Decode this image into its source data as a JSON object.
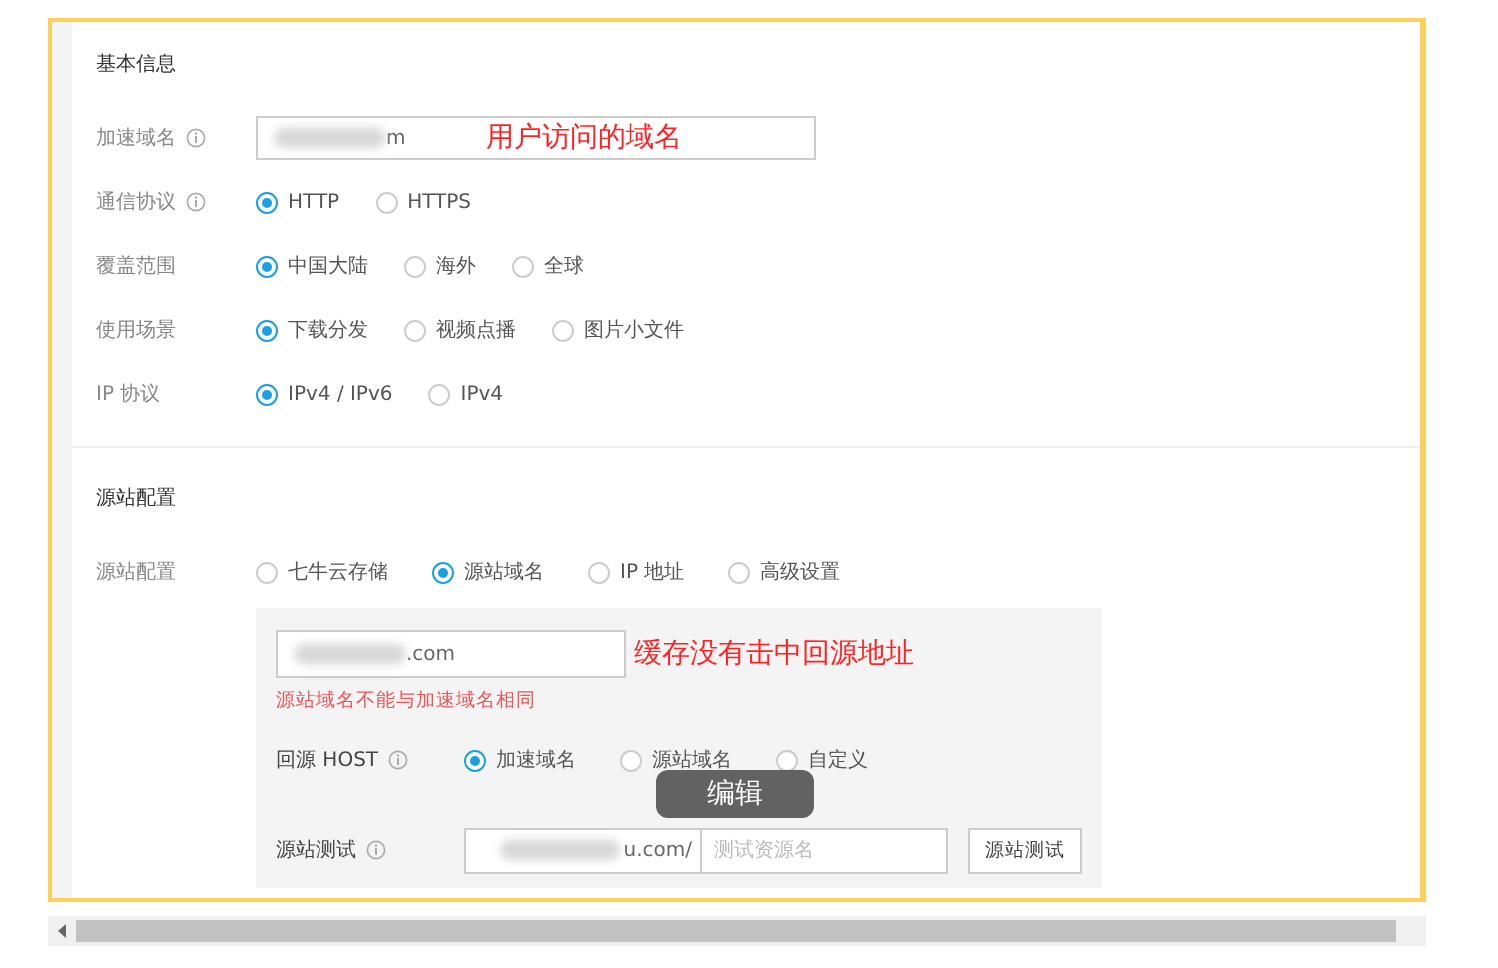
{
  "sections": [
    {
      "title": "基本信息",
      "rows": [
        {
          "kind": "input",
          "label": "加速域名",
          "info": true,
          "value": "m",
          "annotation": "用户访问的域名"
        },
        {
          "kind": "radio",
          "label": "通信协议",
          "info": true,
          "options": [
            {
              "label": "HTTP",
              "selected": true
            },
            {
              "label": "HTTPS",
              "selected": false
            }
          ]
        },
        {
          "kind": "radio",
          "label": "覆盖范围",
          "info": false,
          "options": [
            {
              "label": "中国大陆",
              "selected": true
            },
            {
              "label": "海外",
              "selected": false
            },
            {
              "label": "全球",
              "selected": false
            }
          ]
        },
        {
          "kind": "radio",
          "label": "使用场景",
          "info": false,
          "options": [
            {
              "label": "下载分发",
              "selected": true
            },
            {
              "label": "视频点播",
              "selected": false
            },
            {
              "label": "图片小文件",
              "selected": false
            }
          ]
        },
        {
          "kind": "radio",
          "label": "IP 协议",
          "info": false,
          "options": [
            {
              "label": "IPv4 / IPv6",
              "selected": true
            },
            {
              "label": "IPv4",
              "selected": false
            }
          ]
        }
      ]
    },
    {
      "title": "源站配置",
      "rows": [
        {
          "kind": "radio",
          "label": "源站配置",
          "info": false,
          "options": [
            {
              "label": "七牛云存储",
              "selected": false
            },
            {
              "label": "源站域名",
              "selected": true
            },
            {
              "label": "IP 地址",
              "selected": false
            },
            {
              "label": "高级设置",
              "selected": false
            }
          ]
        }
      ]
    }
  ],
  "origin_panel": {
    "value": ".com",
    "annotation": "缓存没有击中回源地址",
    "error": "源站域名不能与加速域名相同",
    "host": {
      "label": "回源 HOST",
      "info": true,
      "options": [
        {
          "label": "加速域名",
          "selected": true
        },
        {
          "label": "源站域名",
          "selected": false
        },
        {
          "label": "自定义",
          "selected": false
        }
      ]
    },
    "test": {
      "label": "源站测试",
      "info": true,
      "value": "u.com/",
      "placeholder": "测试资源名",
      "button": "源站测试"
    }
  },
  "overlay_button": "编辑"
}
